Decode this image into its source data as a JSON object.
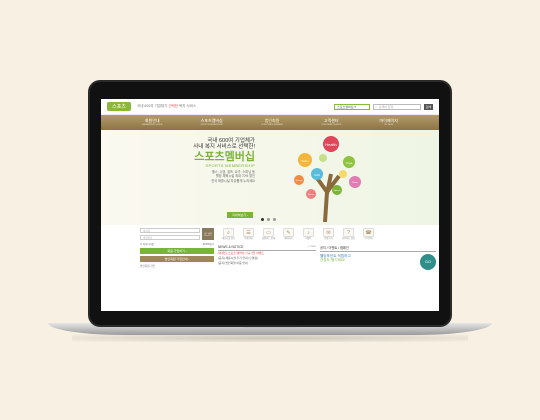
{
  "header": {
    "logo_text": "스포츠",
    "tagline_pre": "국내 600여 기업체가",
    "tagline_hl": "선택한",
    "tagline_post": "복지 서비스",
    "select_label": "스포츠멤버십 ▾",
    "search_placeholder": "검색어 입력",
    "search_button": "검색"
  },
  "nav": [
    {
      "label": "회원안내",
      "sub": "MEMBERSHIP GUIDE"
    },
    {
      "label": "스포츠멤버십",
      "sub": "SPORTS MEMBERSHIP"
    },
    {
      "label": "법인회원",
      "sub": "CORPORATE MEMBER"
    },
    {
      "label": "고객센터",
      "sub": "CUSTOMER CENTER"
    },
    {
      "label": "마이페이지",
      "sub": "MY PAGE"
    }
  ],
  "hero": {
    "line1": "국내 600여 기업체가",
    "line2": "사내 복지 서비스로 선택한!",
    "big": "스포츠멤버십",
    "eng": "SPORTS MEMBERSHIP",
    "desc1": "헬스, 수영, 골프, 요가, 스피닝 등",
    "desc2": "웰빙 체육시설 최대 70% 할인",
    "desc3": "전국 제휴시설 자유롭게 누리세요",
    "button": "자세히보기 ›",
    "bubbles": [
      "Health",
      "Swim",
      "Yoga",
      "Golf",
      "Spinning",
      "Pilates",
      "Squash",
      "Dance"
    ]
  },
  "login": {
    "id_placeholder": "아이디",
    "pw_placeholder": "비밀번호",
    "button": "로그인",
    "save_id": "아이디저장",
    "find": "ID/PW찾기",
    "join": "회원 가입하기 ›",
    "corp": "법인회원 가입안내 ›",
    "caption": "법인회원 가입"
  },
  "icons": [
    {
      "name": "facility-search",
      "symbol": "⌕",
      "label": "제휴시설 찾기"
    },
    {
      "name": "usage-guide",
      "symbol": "☰",
      "label": "이용안내"
    },
    {
      "name": "card-guide",
      "symbol": "▭",
      "label": "회원카드 안내"
    },
    {
      "name": "booking",
      "symbol": "✎",
      "label": "예약하기"
    },
    {
      "name": "event",
      "symbol": "♪",
      "label": "이벤트"
    },
    {
      "name": "review",
      "symbol": "✉",
      "label": "이용후기"
    },
    {
      "name": "faq",
      "symbol": "?",
      "label": "자주하는 질문"
    },
    {
      "name": "contact",
      "symbol": "☎",
      "label": "1:1 문의"
    }
  ],
  "news": {
    "title": "NEWS & NOTICE",
    "more": "+ more",
    "items": [
      "[이벤트] 스포츠 멤버십 신규가입 이벤트",
      "[공지] 제휴시설 추가 안내 (수영장)",
      "[공지] 법인회원 이용 안내"
    ]
  },
  "campaign": {
    "title": "공지 / 이벤트 / 캠페인",
    "line1": "웰빙포인트 적립하고",
    "line2": "건강도 챙기세요!",
    "badge": "GO"
  }
}
